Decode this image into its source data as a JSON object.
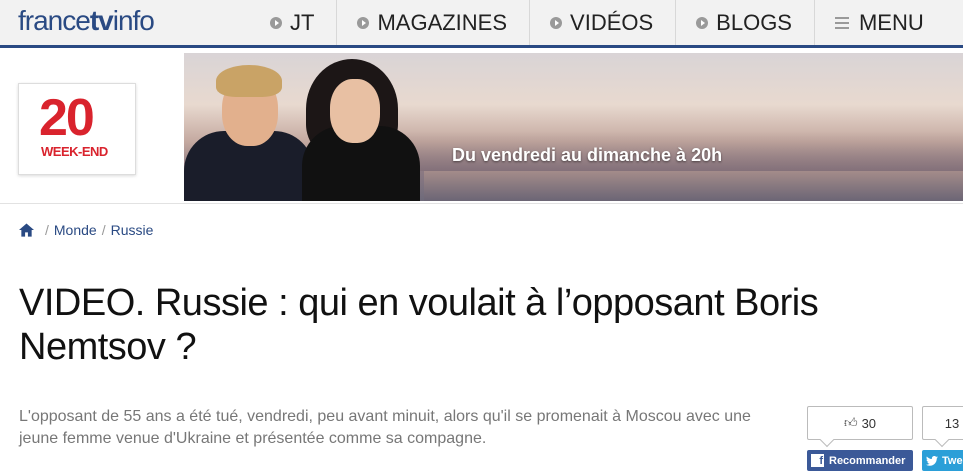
{
  "header": {
    "logo": {
      "part1": "france",
      "part2": "tv",
      "part3": "info"
    },
    "nav": [
      {
        "label": "JT"
      },
      {
        "label": "MAGAZINES"
      },
      {
        "label": "VIDÉOS"
      },
      {
        "label": "BLOGS"
      },
      {
        "label": "MENU"
      }
    ]
  },
  "banner": {
    "badge_number": "20",
    "badge_sub": "WEEK-END",
    "tagline": "Du vendredi au dimanche à 20h"
  },
  "breadcrumb": {
    "items": [
      "Monde",
      "Russie"
    ]
  },
  "article": {
    "title": "VIDEO. Russie : qui en voulait à l’opposant Boris Nemtsov ?",
    "lead": "L'opposant de 55 ans a été tué, vendredi, peu avant minuit, alors qu'il se promenait à Moscou avec une jeune femme venue d'Ukraine et présentée comme sa compagne."
  },
  "share": {
    "facebook": {
      "count": "30",
      "label": "Recommander"
    },
    "twitter": {
      "count": "13",
      "label": "Tweet"
    }
  },
  "colors": {
    "brand_blue": "#2a4a83",
    "badge_red": "#d9232d",
    "facebook": "#3b5998",
    "twitter": "#2b9fd8"
  }
}
